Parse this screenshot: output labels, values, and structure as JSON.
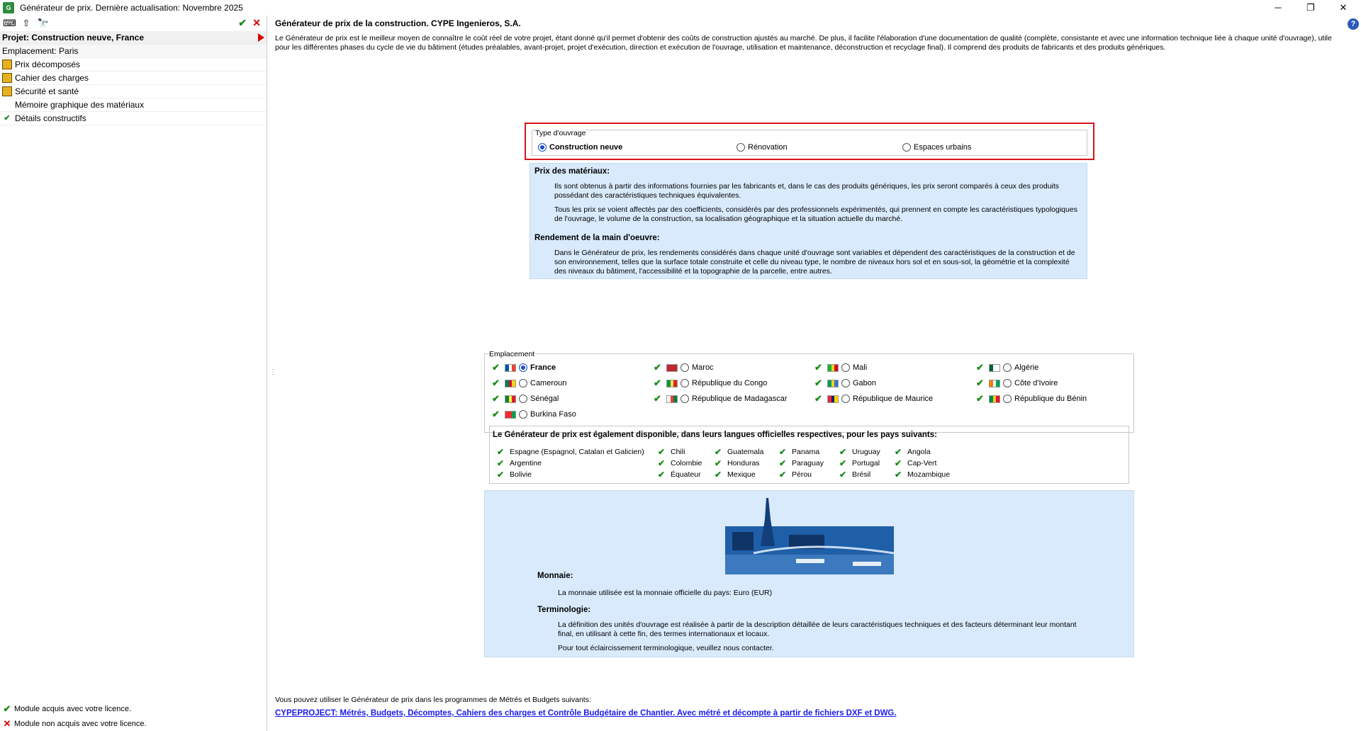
{
  "window": {
    "title": "Générateur de prix. Dernière actualisation: Novembre 2025"
  },
  "sidebar": {
    "project": "Projet: Construction neuve, France",
    "location": "Emplacement: Paris",
    "items": [
      {
        "label": "Prix décomposés",
        "icon": "price-icon"
      },
      {
        "label": "Cahier des charges",
        "icon": "document-icon"
      },
      {
        "label": "Sécurité et santé",
        "icon": "safety-icon"
      },
      {
        "label": "Mémoire graphique des matériaux",
        "icon": ""
      },
      {
        "label": "Détails constructifs",
        "icon": "check-icon"
      }
    ],
    "legend_acquired": "Module acquis avec votre licence.",
    "legend_not_acquired": "Module non acquis avec votre licence."
  },
  "main": {
    "title": "Générateur de prix de la construction. CYPE Ingenieros, S.A.",
    "intro": "Le Générateur de prix est le meilleur moyen de connaître le coût réel de votre projet, étant donné qu'il permet d'obtenir des coûts de construction ajustés au marché. De plus, il facilite l'élaboration d'une documentation de qualité (complète, consistante et avec une information technique liée à chaque unité d'ouvrage), utile pour les différentes phases du cycle de vie du bâtiment (études préalables, avant-projet, projet d'exécution, direction et exécution de l'ouvrage, utilisation et maintenance, déconstruction et recyclage final). Il comprend des produits de fabricants et des produits génériques.",
    "type_group": "Type d'ouvrage",
    "type_options": [
      "Construction neuve",
      "Rénovation",
      "Espaces urbains"
    ],
    "prix_heading": "Prix des matériaux:",
    "prix_p1": "Ils sont obtenus à partir des informations fournies par les fabricants et, dans le cas des produits génériques, les prix seront comparés à ceux des produits possédant des caractéristiques techniques équivalentes.",
    "prix_p2": "Tous les prix se voient affectés par des coefficients, considérés par des professionnels expérimentés, qui prennent en compte les caractéristiques typologiques de l'ouvrage, le volume de la construction, sa localisation géographique et la situation actuelle du marché.",
    "rendement_heading": "Rendement de la main d'oeuvre:",
    "rendement_p": "Dans le Générateur de prix, les rendements considérés dans chaque unité d'ouvrage sont variables et dépendent des caractéristiques de la construction et de son environnement, telles que la surface totale construite et celle du niveau type, le nombre de niveaux hors sol et en sous-sol, la géométrie et la complexité des niveaux du bâtiment, l'accessibilité et la topographie de la parcelle, entre autres.",
    "emplacement_group": "Emplacement",
    "countries": [
      {
        "name": "France",
        "flag": [
          "#0055a4",
          "#ffffff",
          "#ef4135"
        ]
      },
      {
        "name": "Maroc",
        "flag": [
          "#c1272d",
          "#c1272d",
          "#c1272d"
        ]
      },
      {
        "name": "Mali",
        "flag": [
          "#14b53a",
          "#fcd116",
          "#ce1126"
        ]
      },
      {
        "name": "Algérie",
        "flag": [
          "#006233",
          "#ffffff",
          "#ffffff"
        ]
      },
      {
        "name": "Cameroun",
        "flag": [
          "#007a5e",
          "#ce1126",
          "#fcd116"
        ]
      },
      {
        "name": "République du Congo",
        "flag": [
          "#009543",
          "#fbde4a",
          "#dc241f"
        ]
      },
      {
        "name": "Gabon",
        "flag": [
          "#009e60",
          "#fcd116",
          "#3a75c4"
        ]
      },
      {
        "name": "Côte d'Ivoire",
        "flag": [
          "#f77f00",
          "#ffffff",
          "#009e60"
        ]
      },
      {
        "name": "Sénégal",
        "flag": [
          "#00853f",
          "#fdef42",
          "#e31b23"
        ]
      },
      {
        "name": "République de Madagascar",
        "flag": [
          "#ffffff",
          "#fc3d32",
          "#007e3a"
        ]
      },
      {
        "name": "République de Maurice",
        "flag": [
          "#ea2839",
          "#1a206d",
          "#ffd500"
        ]
      },
      {
        "name": "République du Bénin",
        "flag": [
          "#008751",
          "#fcd116",
          "#e8112d"
        ]
      },
      {
        "name": "Burkina Faso",
        "flag": [
          "#ef2b2d",
          "#ef2b2d",
          "#009e49"
        ]
      }
    ],
    "also_title": "Le Générateur de prix est également disponible, dans leurs langues officielles respectives, pour les pays suivants:",
    "also_countries": [
      "Espagne (Espagnol, Catalan et Galicien)",
      "Argentine",
      "Bolivie",
      "Chili",
      "Colombie",
      "Équateur",
      "Guatemala",
      "Honduras",
      "Mexique",
      "Panama",
      "Paraguay",
      "Pérou",
      "Uruguay",
      "Portugal",
      "Brésil",
      "Angola",
      "Cap-Vert",
      "Mozambique"
    ],
    "monnaie_heading": "Monnaie:",
    "monnaie_p": "La monnaie utilisée est la monnaie officielle du pays: Euro (EUR)",
    "terminologie_heading": "Terminologie:",
    "terminologie_p1": "La définition des unités d'ouvrage est réalisée à partir de la description détaillée de leurs caractéristiques techniques et des facteurs déterminant leur montant final, en utilisant à cette fin, des termes internationaux et locaux.",
    "terminologie_p2": "Pour tout éclaircissement terminologique, veuillez nous contacter.",
    "footer_text": "Vous pouvez utiliser le Générateur de prix dans les programmes de Métrés et Budgets suivants:",
    "footer_link": "CYPEPROJECT: Métrés, Budgets, Décomptes, Cahiers des charges et Contrôle Budgétaire de Chantier. Avec métré et décompte à partir de fichiers DXF et DWG."
  },
  "colors": {
    "accent_red": "#d4141c",
    "info_bg": "#d9eafc",
    "check_green": "#1a8a1a",
    "link_blue": "#1a1aee"
  }
}
